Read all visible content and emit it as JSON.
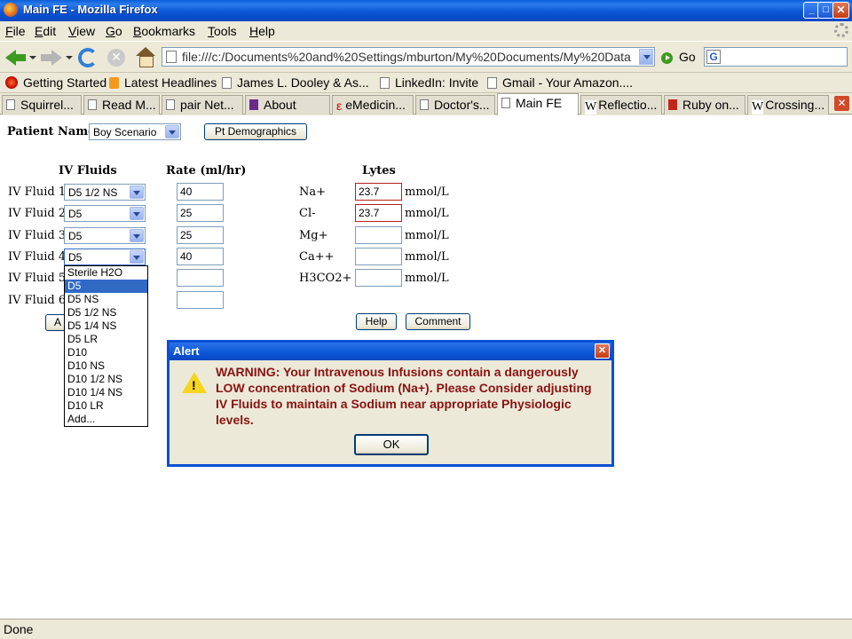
{
  "window": {
    "title": "Main FE - Mozilla Firefox"
  },
  "menu": [
    "File",
    "Edit",
    "View",
    "Go",
    "Bookmarks",
    "Tools",
    "Help"
  ],
  "nav": {
    "url": "file:///c:/Documents%20and%20Settings/mburton/My%20Documents/My%20Data",
    "go_label": "Go",
    "search_value": ""
  },
  "bookmarks": [
    "Getting Started",
    "Latest Headlines",
    "James L. Dooley & As...",
    "LinkedIn: Invite",
    "Gmail - Your Amazon...."
  ],
  "tabs": [
    "Squirrel...",
    "Read M...",
    "pair Net...",
    "About",
    "eMedicin...",
    "Doctor's...",
    "Main FE",
    "Reflectio...",
    "Ruby on...",
    "Crossing..."
  ],
  "active_tab": "Main FE",
  "patient": {
    "label": "Patient Name:",
    "selected": "Boy Scenario",
    "demographics_button": "Pt Demographics"
  },
  "headers": {
    "fluids": "IV Fluids",
    "rate": "Rate (ml/hr)",
    "lytes": "Lytes"
  },
  "fluids": [
    {
      "label": "IV Fluid 1",
      "selected": "D5 1/2 NS",
      "rate": "40"
    },
    {
      "label": "IV Fluid 2",
      "selected": "D5",
      "rate": "25"
    },
    {
      "label": "IV Fluid 3",
      "selected": "D5",
      "rate": "25"
    },
    {
      "label": "IV Fluid 4",
      "selected": "D5",
      "rate": "40"
    },
    {
      "label": "IV Fluid 5",
      "selected": "",
      "rate": ""
    },
    {
      "label": "IV Fluid 6",
      "selected": "",
      "rate": ""
    }
  ],
  "add_button_fragment": "A",
  "dropdown_options": [
    "Sterile H2O",
    "D5",
    "D5 NS",
    "D5 1/2 NS",
    "D5 1/4 NS",
    "D5 LR",
    "D10",
    "D10 NS",
    "D10 1/2 NS",
    "D10 1/4 NS",
    "D10 LR",
    "Add..."
  ],
  "dropdown_highlighted": "D5",
  "lytes": [
    {
      "label": "Na+",
      "value": "23.7",
      "unit": "mmol/L"
    },
    {
      "label": "Cl-",
      "value": "23.7",
      "unit": "mmol/L"
    },
    {
      "label": "Mg+",
      "value": "",
      "unit": "mmol/L"
    },
    {
      "label": "Ca++",
      "value": "",
      "unit": "mmol/L"
    },
    {
      "label": "H3CO2+",
      "value": "",
      "unit": "mmol/L"
    }
  ],
  "buttons": {
    "help": "Help",
    "comment": "Comment"
  },
  "alert": {
    "title": "Alert",
    "message": "WARNING:  Your Intravenous Infusions contain a dangerously LOW concentration of Sodium (Na+).  Please Consider adjusting IV Fluids to maintain a Sodium near appropriate Physiologic levels.",
    "ok_label": "OK"
  },
  "status": "Done",
  "colors": {
    "title_bar": "#0b56d6",
    "warning_text": "#8a1212",
    "highlight": "#316ac5",
    "warn_border": "#b42020"
  }
}
